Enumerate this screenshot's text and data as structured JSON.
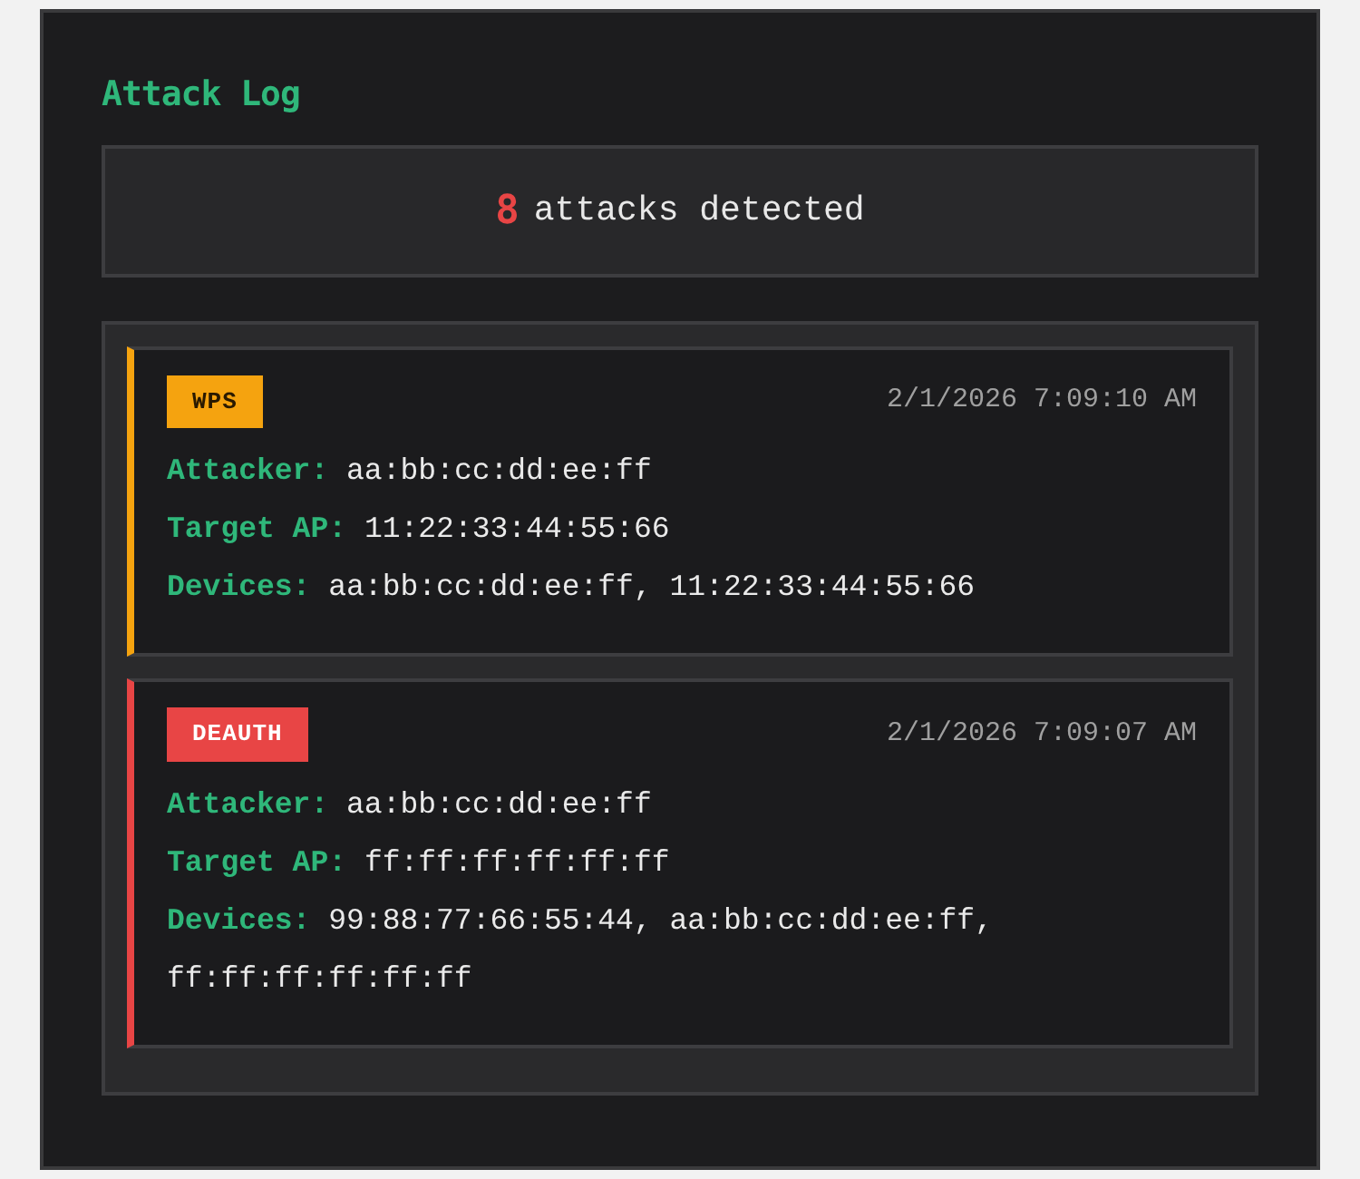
{
  "title": "Attack Log",
  "summary": {
    "count": "8",
    "text": "attacks detected"
  },
  "attacks": [
    {
      "type": "WPS",
      "color": "#f5a30f",
      "time": "2/1/2026 7:09:10 AM",
      "fields": [
        {
          "label": "Attacker:",
          "value": "aa:bb:cc:dd:ee:ff"
        },
        {
          "label": "Target AP:",
          "value": "11:22:33:44:55:66"
        },
        {
          "label": "Devices:",
          "value": "aa:bb:cc:dd:ee:ff, 11:22:33:44:55:66"
        }
      ]
    },
    {
      "type": "DEAUTH",
      "color": "#e84545",
      "time": "2/1/2026 7:09:07 AM",
      "fields": [
        {
          "label": "Attacker:",
          "value": "aa:bb:cc:dd:ee:ff"
        },
        {
          "label": "Target AP:",
          "value": "ff:ff:ff:ff:ff:ff"
        },
        {
          "label": "Devices:",
          "value": "99:88:77:66:55:44, aa:bb:cc:dd:ee:ff, ff:ff:ff:ff:ff:ff"
        }
      ]
    }
  ]
}
